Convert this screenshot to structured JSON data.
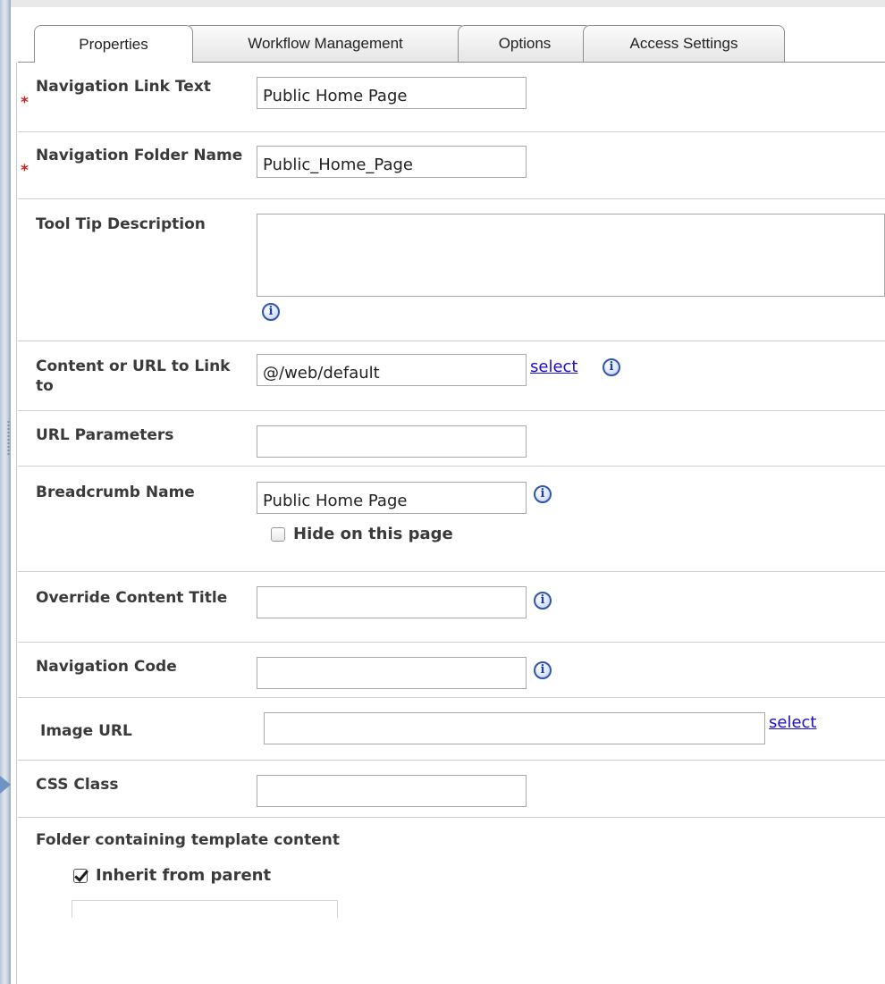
{
  "tabs": [
    {
      "label": "Properties",
      "active": true
    },
    {
      "label": "Workflow Management",
      "active": false
    },
    {
      "label": "Options",
      "active": false
    },
    {
      "label": "Access Settings",
      "active": false
    }
  ],
  "form": {
    "nav_link_text": {
      "label": "Navigation Link Text",
      "value": "Public Home Page",
      "required_mark": "*"
    },
    "nav_folder_name": {
      "label": "Navigation Folder Name",
      "value": "Public_Home_Page",
      "required_mark": "*"
    },
    "tooltip": {
      "label": "Tool Tip Description",
      "value": ""
    },
    "content_url": {
      "label": "Content or URL to Link to",
      "value": "@/web/default",
      "select_link": "select"
    },
    "url_params": {
      "label": "URL Parameters",
      "value": ""
    },
    "breadcrumb": {
      "label": "Breadcrumb Name",
      "value": "Public Home Page",
      "hide_label": "Hide on this page",
      "hide_checked": false
    },
    "override_title": {
      "label": "Override Content Title",
      "value": ""
    },
    "nav_code": {
      "label": "Navigation Code",
      "value": ""
    },
    "image_url": {
      "label": "Image URL",
      "value": "",
      "select_link": "select"
    },
    "css_class": {
      "label": "CSS Class",
      "value": ""
    },
    "template_folder": {
      "label": "Folder containing template content",
      "inherit_label": "Inherit from parent",
      "inherit_checked": true
    }
  },
  "info_icon": {
    "glyph": "i",
    "color": "#2f55b5"
  },
  "colors": {
    "required": "#c81e1e",
    "link": "#1a0dcc",
    "divider": "#cfcfcf"
  }
}
